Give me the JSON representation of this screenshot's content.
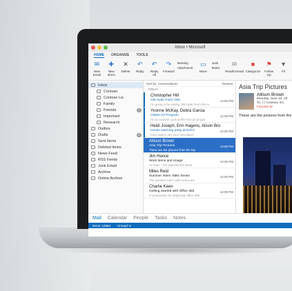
{
  "window": {
    "title": "Inbox • Microsoft"
  },
  "tabs": [
    {
      "label": "HOME"
    },
    {
      "label": "ORGANIZE"
    },
    {
      "label": "TOOLS"
    }
  ],
  "ribbon": {
    "new_email": "New Email",
    "new_items": "New Items",
    "delete": "Delete",
    "reply": "Reply",
    "reply_all": "Reply All",
    "forward": "Forward",
    "meeting": "Meeting",
    "attachment": "Attachment",
    "move": "Move",
    "junk": "Junk",
    "rules": "Rules",
    "read_unread": "Read/Unread",
    "categorize": "Categorize",
    "follow_up": "Follow Up",
    "filter": "Fil"
  },
  "nav": {
    "items": [
      {
        "label": "Inbox",
        "sel": true
      },
      {
        "label": "Contoso",
        "sub": true
      },
      {
        "label": "Contoso Lis",
        "sub": true
      },
      {
        "label": "Family",
        "sub": true
      },
      {
        "label": "Friends",
        "sub": true,
        "count": "8"
      },
      {
        "label": "Important",
        "sub": true
      },
      {
        "label": "Research",
        "sub": true
      },
      {
        "label": "Outbox"
      },
      {
        "label": "Drafts",
        "count": "6"
      },
      {
        "label": "Sent Items"
      },
      {
        "label": "Deleted Items"
      },
      {
        "label": "News Feed"
      },
      {
        "label": "RSS Feeds"
      },
      {
        "label": "Junk Email"
      },
      {
        "label": "Archive"
      },
      {
        "label": "Online Archive"
      }
    ]
  },
  "list": {
    "sort_label": "Sort by: Conversations",
    "sort_order": "Newest",
    "group_today": "TODAY",
    "messages": [
      {
        "from": "Christopher Hill",
        "subject": "Old Hyde Farm Visit",
        "preview": "I'm going to be visiting Old Hyde Farm this w",
        "time": "12:00 PM",
        "unread": true
      },
      {
        "from": "Yvonne McKay, Debra Garcia",
        "subject": "Online Art Program",
        "preview": "I'm so excited! Look at this new art progra",
        "time": "12:00 PM",
        "unread": true
      },
      {
        "from": "Heidi Joseph, Erin Hagens, Alison Bro",
        "subject": "House warming party at Erin's",
        "preview": "Can't wait to see your new place!",
        "time": "12:00 PM",
        "unread": true
      },
      {
        "from": "Allison Brown",
        "subject": "Asia Trip Pictures",
        "preview": "These are the pictures from the trip",
        "time": "12:00 PM",
        "sel": true
      },
      {
        "from": "Jim Hance",
        "subject": "Work Items and Usage",
        "preview": "Hi Team - I've attached the latest",
        "time": "12:00 PM",
        "plain": true
      },
      {
        "from": "Miles Reid",
        "subject": "Summer Intern Talks Series",
        "preview": "The summer intern talks series are",
        "time": "12:00 PM",
        "plain": true
      },
      {
        "from": "Charlie Keen",
        "subject": "Getting Started with Office 365",
        "preview": "In preparation for deploying Office 365",
        "time": "12:00 PM",
        "plain": true
      }
    ]
  },
  "reading": {
    "title": "Asia Trip Pictures",
    "sender": "Allison Brown",
    "date": "Monday, June 24, 20",
    "to": "To: ☐ Contoso Inc.",
    "category": "Favorite M",
    "body": "These are the pictures from the"
  },
  "bottomnav": [
    {
      "label": "Mail",
      "active": true
    },
    {
      "label": "Calendar"
    },
    {
      "label": "People"
    },
    {
      "label": "Tasks"
    },
    {
      "label": "Notes"
    }
  ],
  "status": {
    "items": "Items: 12994",
    "unread": "Unread: 5"
  }
}
